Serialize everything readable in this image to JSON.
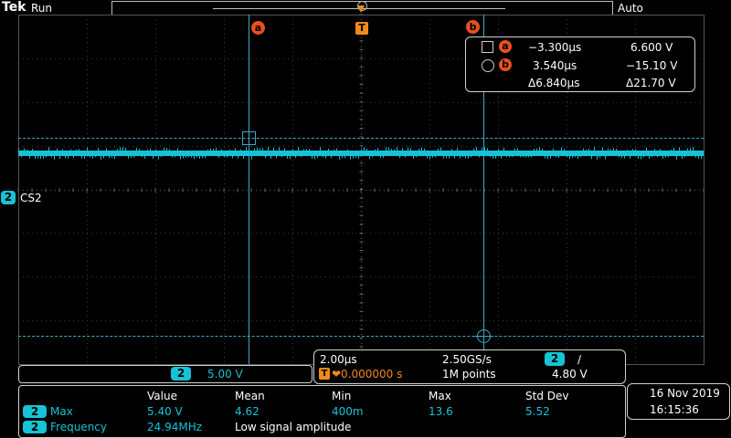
{
  "header": {
    "brand": "Tek",
    "run_state": "Run",
    "trigger_mode": "Auto",
    "trigger_marker": "T"
  },
  "cursors": {
    "a_label": "a",
    "b_label": "b",
    "readout": {
      "a_time": "−3.300µs",
      "a_value": "6.600 V",
      "b_time": "3.540µs",
      "b_value": "−15.10 V",
      "delta_time": "Δ6.840µs",
      "delta_value": "Δ21.70 V"
    }
  },
  "channel": {
    "number": "2",
    "label": "CS2",
    "scale": "5.00 V",
    "color": "#16c3d6"
  },
  "acquisition": {
    "timebase": "2.00µs",
    "sample_rate": "2.50GS/s",
    "trigger_channel": "2",
    "trigger_slope": "/",
    "trigger_position": "❤0.000000 s",
    "record_length": "1M points",
    "trigger_level": "4.80 V"
  },
  "measurements": {
    "headers": [
      "Value",
      "Mean",
      "Min",
      "Max",
      "Std Dev"
    ],
    "rows": [
      {
        "ch": "2",
        "name": "Max",
        "value": "5.40 V",
        "mean": "4.62",
        "min": "400m",
        "max": "13.6",
        "std": "5.52"
      },
      {
        "ch": "2",
        "name": "Frequency",
        "value": "24.94MHz",
        "note": "Low signal amplitude"
      }
    ]
  },
  "datetime": {
    "date": "16 Nov 2019",
    "time": "16:15:36"
  }
}
